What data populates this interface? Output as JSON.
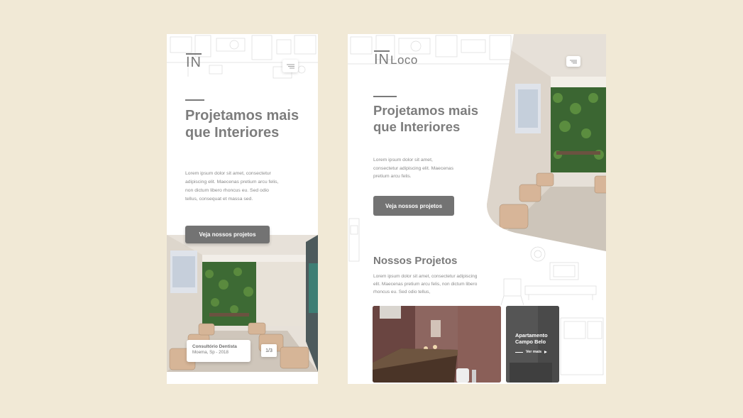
{
  "mobile": {
    "logo_mark": "IN",
    "hero": {
      "title": "Projetamos mais que Interiores",
      "text": "Lorem ipsum dolor sit amet, consectetur adipiscing elit. Maecenas pretium arcu felis, non dictum libero rhoncus eu. Sed odio tellus, consequat et massa sed.",
      "cta": "Veja nossos projetos"
    },
    "project_card": {
      "title": "Consultório Dentista",
      "subtitle": "Moema, Sp - 2018"
    },
    "pager": "1/3"
  },
  "tablet": {
    "logo_mark": "IN",
    "logo_word": "Loco",
    "hero": {
      "title": "Projetamos mais que Interiores",
      "text": "Lorem ipsum dolor sit amet, consectetur adipiscing elit. Maecenas pretium arcu felis.",
      "cta": "Veja nossos projetos"
    },
    "projects": {
      "title": "Nossos Projetos",
      "text": "Lorem ipsum dolor sit amet, consectetur adipiscing elit. Maecenas pretium arcu felis, non dictum libero rhoncus eu. Sed odio tellus,",
      "cards": [
        {
          "title": "Apartamento Campo Belo",
          "link": "Ver mais"
        }
      ]
    }
  },
  "colors": {
    "background": "#f1e9d6",
    "text_gray": "#7d7d7d",
    "button": "#737373"
  },
  "icons": [
    "menu-icon",
    "arrow-right-icon"
  ]
}
